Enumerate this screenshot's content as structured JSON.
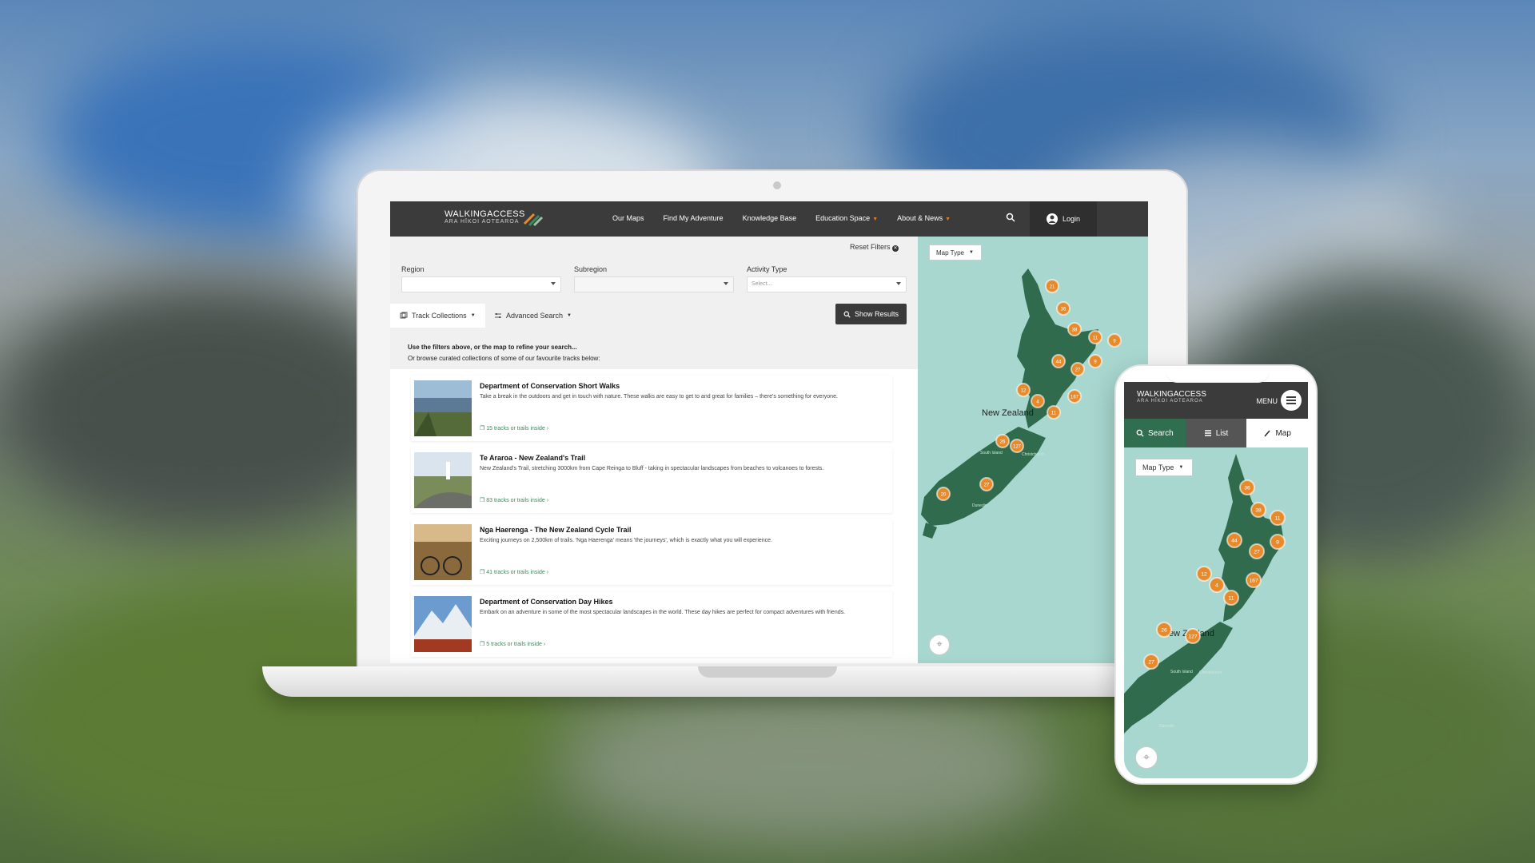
{
  "nav": {
    "brand_main": "WALKINGACCESS",
    "brand_sub": "ARA HĪKOI AOTEAROA",
    "items": [
      {
        "label": "Our Maps"
      },
      {
        "label": "Find My Adventure"
      },
      {
        "label": "Knowledge Base"
      },
      {
        "label": "Education Space",
        "dropdown": true
      },
      {
        "label": "About & News",
        "dropdown": true
      }
    ],
    "login_label": "Login"
  },
  "filters": {
    "reset_label": "Reset Filters",
    "region_label": "Region",
    "subregion_label": "Subregion",
    "activity_label": "Activity Type",
    "activity_placeholder": "Select..."
  },
  "tabs": {
    "track_collections": "Track Collections",
    "advanced_search": "Advanced Search",
    "show_results": "Show Results"
  },
  "intro": {
    "line1": "Use the filters above, or the map to refine your search...",
    "line2": "Or browse curated collections of some of our favourite tracks below:"
  },
  "collections": [
    {
      "title": "Department of Conservation Short Walks",
      "desc": "Take a break in the outdoors and get in touch with nature. These walks are easy to get to and great for families – there's something for everyone.",
      "link": "15 tracks or trails inside"
    },
    {
      "title": "Te Araroa - New Zealand's Trail",
      "desc": "New Zealand's Trail, stretching 3000km from Cape Reinga to Bluff - taking in spectacular landscapes from beaches to volcanoes to forests.",
      "link": "83 tracks or trails inside"
    },
    {
      "title": "Nga Haerenga - The New Zealand Cycle Trail",
      "desc": "Exciting journeys on 2,500km of trails. 'Nga Haerenga' means 'the journeys', which is exactly what you will experience.",
      "link": "41 tracks or trails inside"
    },
    {
      "title": "Department of Conservation Day Hikes",
      "desc": "Embark on an adventure in some of the most spectacular landscapes in the world. These day hikes are perfect for compact adventures with friends.",
      "link": "5 tracks or trails inside"
    }
  ],
  "map": {
    "type_label": "Map Type",
    "country_label": "New Zealand",
    "island_label": "South Island",
    "city_label": "Dunedin",
    "city2_label": "Christchurch",
    "land_color": "#2f6b4c",
    "sea_color": "#a8d7cf",
    "cluster_color": "#e98a2a",
    "clusters": [
      "21",
      "36",
      "38",
      "11",
      "9",
      "44",
      "27",
      "9",
      "12",
      "4",
      "11",
      "167",
      "26",
      "127",
      "27",
      "20"
    ]
  },
  "phone": {
    "brand_main": "WALKINGACCESS",
    "brand_sub": "ARA HĪKOI AOTEAROA",
    "menu_label": "MENU",
    "tab_search": "Search",
    "tab_list": "List",
    "tab_map": "Map",
    "map_type": "Map Type",
    "country_label": "New Zealand",
    "island_label": "South Island",
    "city_label": "Dunedin",
    "city2_label": "Christchurch",
    "clusters": [
      "36",
      "38",
      "11",
      "44",
      "27",
      "9",
      "12",
      "4",
      "167",
      "11",
      "26",
      "127",
      "27"
    ]
  }
}
